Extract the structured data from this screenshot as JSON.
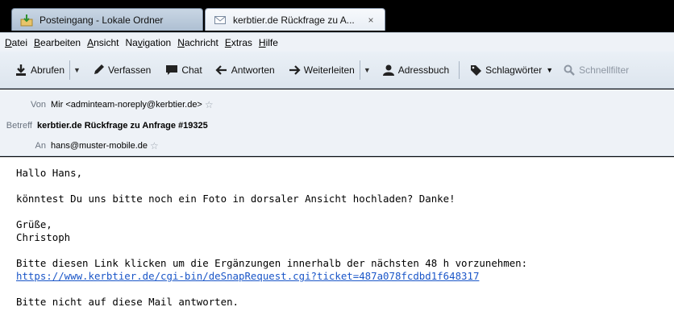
{
  "tabs": [
    {
      "label": "Posteingang - Lokale Ordner",
      "icon": "inbox-icon"
    },
    {
      "label": "kerbtier.de Rückfrage zu A...",
      "icon": "envelope-icon",
      "close": "×"
    }
  ],
  "menu": [
    {
      "pre": "",
      "u": "D",
      "post": "atei"
    },
    {
      "pre": "",
      "u": "B",
      "post": "earbeiten"
    },
    {
      "pre": "",
      "u": "A",
      "post": "nsicht"
    },
    {
      "pre": "Na",
      "u": "v",
      "post": "igation"
    },
    {
      "pre": "",
      "u": "N",
      "post": "achricht"
    },
    {
      "pre": "",
      "u": "E",
      "post": "xtras"
    },
    {
      "pre": "",
      "u": "H",
      "post": "ilfe"
    }
  ],
  "toolbar": {
    "abrufen": "Abrufen",
    "verfassen": "Verfassen",
    "chat": "Chat",
    "antworten": "Antworten",
    "weiterleiten": "Weiterleiten",
    "adressbuch": "Adressbuch",
    "schlagwoerter": "Schlagwörter",
    "schnellfilter": "Schnellfilter"
  },
  "headers": {
    "from_label": "Von",
    "from_value": "Mir <adminteam-noreply@kerbtier.de>",
    "subject_label": "Betreff",
    "subject_value": "kerbtier.de Rückfrage zu Anfrage #19325",
    "to_label": "An",
    "to_value": "hans@muster-mobile.de"
  },
  "body": {
    "greeting": "Hallo Hans,",
    "question": "könntest Du uns bitte noch ein Foto in dorsaler Ansicht hochladen? Danke!",
    "regards": "Grüße,",
    "signature": "Christoph",
    "instruction": "Bitte diesen Link klicken um die Ergänzungen innerhalb der nächsten 48 h vorzunehmen:",
    "link": "https://www.kerbtier.de/cgi-bin/deSnapRequest.cgi?ticket=487a078fcdbd1f648317",
    "noreply": "Bitte nicht auf diese Mail antworten."
  }
}
